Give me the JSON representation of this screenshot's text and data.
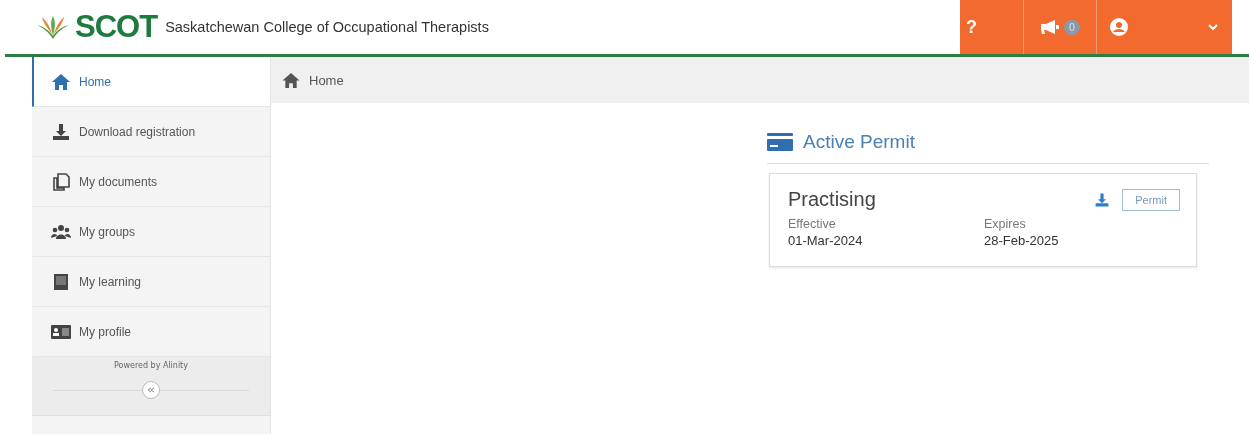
{
  "header": {
    "logo": "SCOT",
    "subtitle": "Saskatchewan College of Occupational Therapists",
    "help": "?",
    "notifications_badge": "0"
  },
  "sidebar": {
    "items": [
      {
        "label": "Home",
        "selected": true
      },
      {
        "label": "Download registration",
        "selected": false
      },
      {
        "label": "My documents",
        "selected": false
      },
      {
        "label": "My groups",
        "selected": false
      },
      {
        "label": "My learning",
        "selected": false
      },
      {
        "label": "My profile",
        "selected": false
      }
    ],
    "footer": "Powered by Alinity"
  },
  "breadcrumb": "Home",
  "permit_panel": {
    "title": "Active Permit",
    "status": "Practising",
    "button": "Permit",
    "fields": [
      {
        "label": "Effective",
        "value": "01-Mar-2024"
      },
      {
        "label": "Expires",
        "value": "28-Feb-2025"
      }
    ]
  }
}
